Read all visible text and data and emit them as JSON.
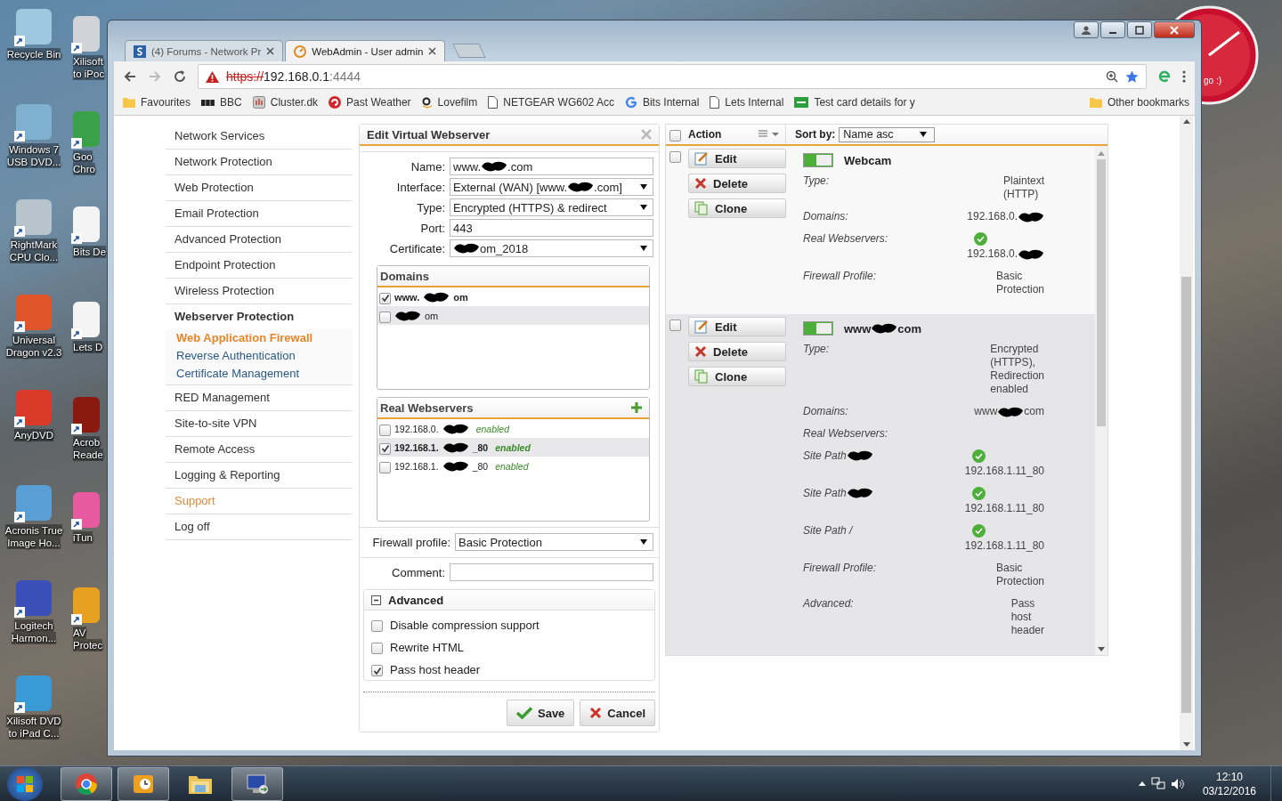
{
  "desktop_icons": [
    {
      "lines": [
        "Recycle Bin"
      ],
      "color": "#9fc7e0"
    },
    {
      "lines": [
        "Windows 7",
        "USB DVD..."
      ],
      "color": "#7fb0d0"
    },
    {
      "lines": [
        "RightMark",
        "CPU Clo..."
      ],
      "color": "#b8c4cc"
    },
    {
      "lines": [
        "Universal",
        "Dragon v2.3"
      ],
      "color": "#e0552a"
    },
    {
      "lines": [
        "AnyDVD"
      ],
      "color": "#d93a2a"
    },
    {
      "lines": [
        "Acronis True",
        "Image Ho..."
      ],
      "color": "#5a9ed6"
    },
    {
      "lines": [
        "Logitech",
        "Harmon..."
      ],
      "color": "#3a4fb8"
    },
    {
      "lines": [
        "Xilisoft DVD",
        "to iPad C..."
      ],
      "color": "#3a9ad6"
    }
  ],
  "desktop_icons_cut": [
    {
      "lines": [
        "Xilisoft",
        "to iPoc"
      ],
      "color": "#d0d4d8"
    },
    {
      "lines": [
        "Goo",
        "Chro"
      ],
      "color": "#3aa04a"
    },
    {
      "lines": [
        "Bits De"
      ],
      "color": "#f4f4f4"
    },
    {
      "lines": [
        "Lets D"
      ],
      "color": "#f4f4f4"
    },
    {
      "lines": [
        "Acrob",
        "Reade"
      ],
      "color": "#8a1a10"
    },
    {
      "lines": [
        "iTun"
      ],
      "color": "#e85aa0"
    },
    {
      "lines": [
        "AV",
        "Protec"
      ],
      "color": "#e8a020"
    }
  ],
  "clock_gadget": {
    "text": "go :)"
  },
  "browser": {
    "tabs": [
      {
        "title": "(4) Forums - Network Pr",
        "kind": "forum",
        "selected": false
      },
      {
        "title": "WebAdmin - User admin",
        "kind": "webadmin",
        "selected": true
      }
    ],
    "address": {
      "scheme": "https://",
      "host": "192.168.0.1",
      "port": ":4444"
    },
    "bookmarks": [
      {
        "label": "Favourites",
        "kind": "folder"
      },
      {
        "label": "BBC",
        "kind": "bbc"
      },
      {
        "label": "Cluster.dk",
        "kind": "cluster"
      },
      {
        "label": "Past Weather",
        "kind": "weather"
      },
      {
        "label": "Lovefilm",
        "kind": "amazon"
      },
      {
        "label": "NETGEAR WG602 Acc",
        "kind": "page"
      },
      {
        "label": "Bits Internal",
        "kind": "google"
      },
      {
        "label": "Lets Internal",
        "kind": "page"
      },
      {
        "label": "Test card details for y",
        "kind": "card"
      }
    ],
    "other_bookmarks": "Other bookmarks"
  },
  "nav": [
    {
      "label": "Network Services",
      "accent": false,
      "expanded": false
    },
    {
      "label": "Network Protection",
      "accent": false,
      "expanded": false
    },
    {
      "label": "Web Protection",
      "accent": false,
      "expanded": false
    },
    {
      "label": "Email Protection",
      "accent": false,
      "expanded": false
    },
    {
      "label": "Advanced Protection",
      "accent": false,
      "expanded": false
    },
    {
      "label": "Endpoint Protection",
      "accent": false,
      "expanded": false
    },
    {
      "label": "Wireless Protection",
      "accent": false,
      "expanded": false
    },
    {
      "label": "Webserver Protection",
      "accent": false,
      "expanded": true,
      "children": [
        {
          "label": "Web Application Firewall",
          "selected": true
        },
        {
          "label": "Reverse Authentication",
          "selected": false
        },
        {
          "label": "Certificate Management",
          "selected": false
        }
      ]
    },
    {
      "label": "RED Management",
      "accent": false,
      "expanded": false
    },
    {
      "label": "Site-to-site VPN",
      "accent": false,
      "expanded": false
    },
    {
      "label": "Remote Access",
      "accent": false,
      "expanded": false
    },
    {
      "label": "Logging & Reporting",
      "accent": false,
      "expanded": false
    },
    {
      "label": "Support",
      "accent": true,
      "expanded": false
    },
    {
      "label": "Log off",
      "accent": false,
      "expanded": false
    }
  ],
  "editor": {
    "title": "Edit Virtual Webserver",
    "fields": [
      {
        "label": "Name:",
        "kind": "text",
        "value": [
          "www.",
          {
            "kind": "redaction"
          },
          ".com"
        ]
      },
      {
        "label": "Interface:",
        "kind": "select",
        "value": [
          "External (WAN) [www.",
          {
            "kind": "redaction"
          },
          ".com]"
        ]
      },
      {
        "label": "Type:",
        "kind": "select",
        "value": "Encrypted (HTTPS) & redirect"
      },
      {
        "label": "Port:",
        "kind": "text",
        "value": "443"
      },
      {
        "label": "Certificate:",
        "kind": "select",
        "value": [
          {
            "kind": "redaction"
          },
          "om_2018"
        ]
      }
    ],
    "domains": {
      "title": "Domains",
      "items": [
        {
          "text": [
            "www.",
            {
              "kind": "redaction"
            },
            "om"
          ],
          "checked": true
        },
        {
          "text": [
            {
              "kind": "redaction"
            },
            "om"
          ],
          "checked": false
        }
      ]
    },
    "webservers": {
      "title": "Real Webservers",
      "items": [
        {
          "text": [
            "192.168.0.",
            {
              "kind": "redaction"
            }
          ],
          "status": "enabled",
          "checked": false
        },
        {
          "text": [
            "192.168.1.",
            {
              "kind": "redaction"
            },
            "_80"
          ],
          "status": "enabled",
          "checked": true
        },
        {
          "text": [
            "192.168.1.",
            {
              "kind": "redaction"
            },
            "_80"
          ],
          "status": "enabled",
          "checked": false
        }
      ]
    },
    "firewall_profile": {
      "label": "Firewall profile:",
      "value": "Basic Protection"
    },
    "comment": {
      "label": "Comment:"
    },
    "advanced": {
      "title": "Advanced",
      "expanded": true,
      "options": [
        {
          "label": "Disable compression support",
          "checked": false
        },
        {
          "label": "Rewrite HTML",
          "checked": false
        },
        {
          "label": "Pass host header",
          "checked": true
        }
      ]
    },
    "buttons": [
      {
        "label": "Save",
        "kind": "save"
      },
      {
        "label": "Cancel",
        "kind": "cancel"
      }
    ]
  },
  "list": {
    "header": {
      "label": "Action",
      "checked": false
    },
    "sort": {
      "label": "Sort by:",
      "value": "Name asc"
    },
    "entries": [
      {
        "checked": false,
        "on": true,
        "name": "Webcam",
        "actions": [
          {
            "label": "Edit",
            "kind": "edit"
          },
          {
            "label": "Delete",
            "kind": "delete"
          },
          {
            "label": "Clone",
            "kind": "clone"
          }
        ],
        "details": [
          {
            "label": "Type:",
            "value": "Plaintext (HTTP)"
          },
          {
            "label": "Domains:",
            "value": [
              "192.168.0.",
              {
                "kind": "redaction"
              }
            ]
          },
          {
            "label": "Real Webservers:",
            "value": [
              "192.168.0.",
              {
                "kind": "redaction"
              }
            ],
            "ok": true
          },
          {
            "label": "Firewall Profile:",
            "value": "Basic Protection"
          }
        ]
      },
      {
        "checked": false,
        "on": true,
        "name": [
          "www",
          {
            "kind": "redaction"
          },
          "com"
        ],
        "actions": [
          {
            "label": "Edit",
            "kind": "edit"
          },
          {
            "label": "Delete",
            "kind": "delete"
          },
          {
            "label": "Clone",
            "kind": "clone"
          }
        ],
        "details": [
          {
            "label": "Type:",
            "value": "Encrypted (HTTPS), Redirection enabled"
          },
          {
            "label": "Domains:",
            "value": [
              "www",
              {
                "kind": "redaction"
              },
              "com"
            ]
          },
          {
            "label": "Real Webservers:"
          },
          {
            "label": [
              "Site Path",
              {
                "kind": "redaction"
              }
            ],
            "value": "192.168.1.11_80",
            "ok": true
          },
          {
            "label": [
              "Site Path",
              {
                "kind": "redaction"
              }
            ],
            "value": "192.168.1.11_80",
            "ok": true
          },
          {
            "label": "Site Path /",
            "value": "192.168.1.11_80",
            "ok": true
          },
          {
            "label": "Firewall Profile:",
            "value": "Basic Protection"
          },
          {
            "label": "Advanced:",
            "value": "Pass host header"
          }
        ]
      }
    ]
  },
  "taskbar": {
    "apps": [
      {
        "kind": "chrome",
        "running": true
      },
      {
        "kind": "outlook",
        "running": true
      },
      {
        "kind": "explorer",
        "running": false
      },
      {
        "kind": "remote",
        "running": true
      }
    ],
    "time": "12:10",
    "date": "03/12/2016"
  }
}
